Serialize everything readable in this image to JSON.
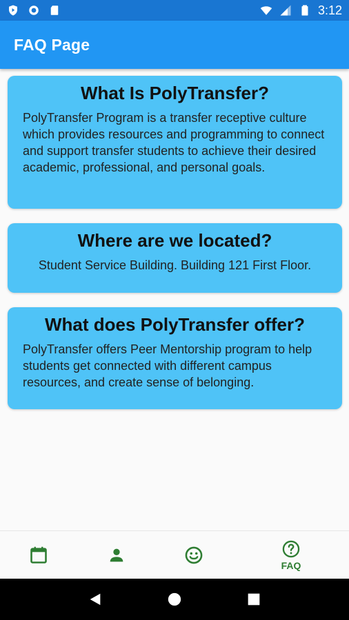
{
  "status_bar": {
    "time": "3:12",
    "icons": [
      "shield-icon",
      "circle-record-icon",
      "sd-card-icon",
      "wifi-icon",
      "signal-icon",
      "battery-icon"
    ]
  },
  "app_bar": {
    "title": "FAQ Page"
  },
  "faq": [
    {
      "question": "What Is PolyTransfer?",
      "answer": "PolyTransfer Program is a transfer receptive culture which provides resources and programming to connect and support transfer students to achieve their desired academic, professional, and personal goals."
    },
    {
      "question": "Where are we located?",
      "answer": "Student Service Building. Building 121 First Floor."
    },
    {
      "question": "What does PolyTransfer offer?",
      "answer": "PolyTransfer offers Peer Mentorship program to help students get connected with different campus resources, and create sense of belonging."
    }
  ],
  "bottom_nav": {
    "items": [
      {
        "icon": "calendar-icon",
        "label": ""
      },
      {
        "icon": "person-icon",
        "label": ""
      },
      {
        "icon": "smiley-icon",
        "label": ""
      },
      {
        "icon": "help-circle-icon",
        "label": "FAQ"
      }
    ],
    "active_color": "#2e7d32"
  },
  "colors": {
    "status_bar": "#1976d2",
    "app_bar": "#2196f3",
    "card": "#4fc3f7",
    "background": "#fafafa"
  }
}
